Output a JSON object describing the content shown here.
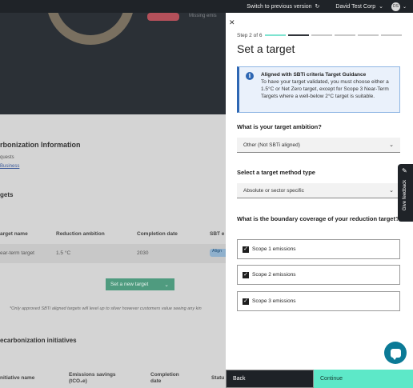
{
  "topbar": {
    "switch_label": "Switch to previous version",
    "switch_icon": "refresh-icon",
    "org_name": "David Test Corp",
    "avatar_initials": "DS"
  },
  "background": {
    "hero": {
      "badge_text": "",
      "side_text": "Missing emis"
    },
    "section_title": "rbonization Information",
    "requests_label": "quests",
    "business_link": "Business",
    "targets_title": "gets",
    "table_headers": [
      "arget name",
      "Reduction ambition",
      "Completion date",
      "SBT e"
    ],
    "row": {
      "name": "ear-term target",
      "ambition": "1.5 °C",
      "date": "2030",
      "tag": "Align"
    },
    "new_target_button": "Set a new target",
    "footnote": "*Only approved SBTi aligned targets will level up to silver however customers value seeing any kin",
    "initiatives_title": "ecarbonization initiatives",
    "initiatives_headers": [
      "nitiative name",
      "Emissions savings",
      "(tCO₂e)",
      "Completion",
      "date",
      "Statu"
    ]
  },
  "drawer": {
    "step_label": "Step 2 of 6",
    "steps_total": 6,
    "current_step": 2,
    "title": "Set a target",
    "info": {
      "icon": "info-icon",
      "title": "Aligned with SBTi criteria Target Guidance",
      "body": "To have your target validated, you must choose either a 1.5°C or Net Zero target, except for Scope 3 Near-Term Targets where a well-below 2°C target is suitable."
    },
    "ambition_question": "What is your target ambition?",
    "ambition_value": "Other (Not SBTi aligned)",
    "method_question": "Select a target method type",
    "method_value": "Absolute or sector specific",
    "boundary_question": "What is the boundary coverage of your reduction target?",
    "scopes": [
      {
        "label": "Scope 1 emissions",
        "checked": true
      },
      {
        "label": "Scope 2 emissions",
        "checked": true
      },
      {
        "label": "Scope 3 emissions",
        "checked": true
      }
    ],
    "back_label": "Back",
    "continue_label": "Continue"
  },
  "feedback": {
    "label": "Give feedback",
    "icon": "pencil-icon"
  }
}
